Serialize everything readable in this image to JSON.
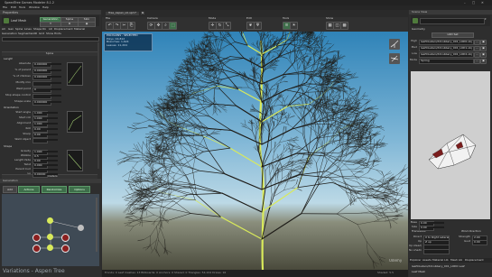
{
  "app": {
    "title": "SpeedTree Games Modeler 8.1.2",
    "menu": [
      "File",
      "Edit",
      "Tools",
      "Window",
      "Help"
    ],
    "window_controls": [
      "–",
      "□",
      "✕"
    ]
  },
  "properties": {
    "title": "Properties",
    "selected_label": "Leaf Mesh",
    "tabs": [
      "Generation",
      "Spine",
      "Skin"
    ],
    "filter_tabs": [
      "All",
      "Gen",
      "Spine",
      "Lines",
      "Shape",
      "Dir",
      "LR",
      "Displacement",
      "Material"
    ],
    "sub_tabs": [
      "Generation",
      "Segments",
      "LOD",
      "Grid",
      "Show Hints"
    ],
    "section_spine": "Spine",
    "length_group": "Length",
    "length_rows": [
      {
        "label": "Absolute",
        "value": "0.000000"
      },
      {
        "label": "% of parent",
        "value": "0.000000"
      },
      {
        "label": "% of children",
        "value": "0.000000"
      },
      {
        "label": "Modify min",
        "value": ""
      },
      {
        "label": "Weld point",
        "value": "0"
      },
      {
        "label": "Stop shape control",
        "value": ""
      },
      {
        "label": "Shape scale",
        "value": "0.000000"
      }
    ],
    "orientation_group": "Orientation",
    "orientation_rows": [
      {
        "label": "Start angle",
        "value": "1.000"
      },
      {
        "label": "Start roll",
        "value": "1.000"
      },
      {
        "label": "Alignment",
        "value": "1.000"
      },
      {
        "label": "Roll",
        "value": "0.00"
      },
      {
        "label": "Sharp",
        "value": "0.00"
      },
      {
        "label": "Weld object",
        "value": ""
      }
    ],
    "shape_group": "Shape",
    "shape_rows": [
      {
        "label": "Gravity",
        "value": "1.000"
      },
      {
        "label": "Wobble",
        "value": "0.5"
      },
      {
        "label": "Length fade",
        "value": "0.00"
      },
      {
        "label": "Twist",
        "value": "0.000"
      },
      {
        "label": "Parent Curl",
        "value": ""
      },
      {
        "label": "Lo",
        "value": "0.00000"
      }
    ],
    "section_skin": "Parameters"
  },
  "generators": {
    "title": "Generation",
    "buttons": [
      "Add",
      "Actions",
      "Randomize",
      "Options"
    ],
    "footer_title": "Variations - Aspen Tree"
  },
  "viewport": {
    "tab_label": "Tree_Aspen_LU.spm*",
    "close_glyph": "✕",
    "menu_labels": [
      "File",
      "Camera",
      "Mode",
      "Edit",
      "Tools",
      "Show"
    ],
    "info_lines": [
      "POLYGONS - SELECTED",
      "Polys: 44,812",
      "Branches: 1,624",
      "Leaves: 11,204"
    ],
    "stats_left": "Fronds: 0   Leaf meshes: 13   Billboards: 0   Anchors: 0   Shared: 0   Triangles: 54,104   Draws: 16",
    "stats_right": "Shaded: 5.5",
    "watermark": "Udemy"
  },
  "scene_view": {
    "title": "Scene View",
    "geometry_title": "Geometry",
    "lod_button": "LOD Set",
    "mesh_rows": [
      {
        "label": "High",
        "value": "leafClusters/Shrubbery_001_LOD0.obj"
      },
      {
        "label": "Med",
        "value": "leafClusters/Shrubbery_001_LOD1.obj"
      },
      {
        "label": "Low",
        "value": "leafClusters/Shrubbery_001_LOD2.obj"
      },
      {
        "label": "Mode",
        "value": "Spring"
      }
    ],
    "lower_rows": [
      {
        "label": "Base",
        "value": "0.00"
      },
      {
        "label": "Size",
        "value": "0.00"
      }
    ],
    "lower_groups": [
      "Translation",
      "Wind direction"
    ],
    "translate_rows": [
      {
        "label": "Direct",
        "value": "X to Right Lateral"
      },
      {
        "label": "Up",
        "value": "Z up"
      },
      {
        "label": "Up steady",
        "value": ""
      },
      {
        "label": "No shading",
        "value": ""
      }
    ],
    "wind_rows": [
      {
        "label": "Strength",
        "value": "2.00"
      },
      {
        "label": "Gust",
        "value": "0.00"
      }
    ],
    "footer_tabs": [
      "Explorer",
      "Assets",
      "Material Lib",
      "Mesh Lib",
      "Displacement"
    ],
    "tree_items": [
      "leafClusters/Shrubbery_001_LOD0 Leaf",
      "Leaf Mesh"
    ]
  },
  "colors": {
    "sky_top": "#2f83b8",
    "sky_bottom": "#bcd9e6",
    "ground": "#4a4a3c",
    "selection": "#d9ea5b",
    "accent_green": "#3e6e4a"
  },
  "icons": [
    "sparkle-icon",
    "close-icon",
    "gear-icon",
    "eye-icon",
    "lock-icon",
    "plus-icon",
    "chevron-down-icon",
    "tree-icon",
    "leaf-icon",
    "target-icon",
    "mesh-icon"
  ]
}
